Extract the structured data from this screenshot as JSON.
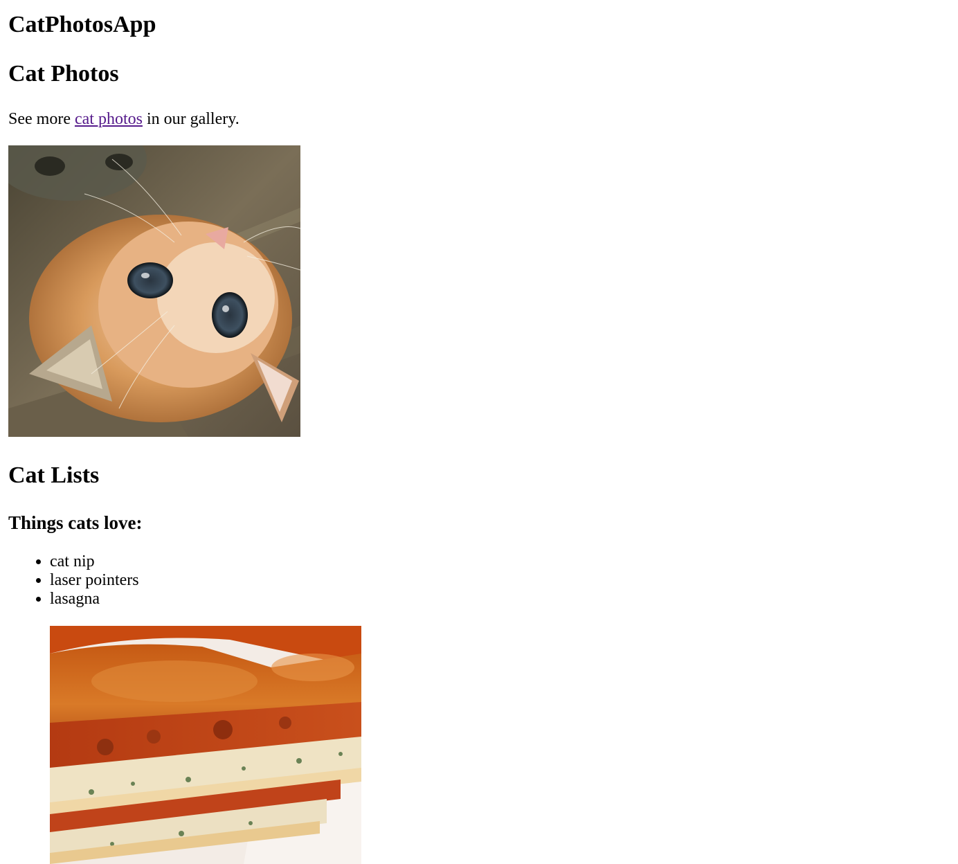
{
  "app": {
    "title": "CatPhotosApp"
  },
  "photos_section": {
    "heading": "Cat Photos",
    "intro_before": "See more ",
    "intro_link": "cat photos",
    "intro_after": " in our gallery.",
    "image_subject": "orange kitten lying on its back looking up"
  },
  "lists_section": {
    "heading": "Cat Lists",
    "subheading": "Things cats love:",
    "items": [
      "cat nip",
      "laser pointers",
      "lasagna"
    ],
    "image_subject": "slice of lasagna on a plate"
  },
  "colors": {
    "link_visited": "#551a8b",
    "text": "#000000",
    "background": "#ffffff"
  }
}
